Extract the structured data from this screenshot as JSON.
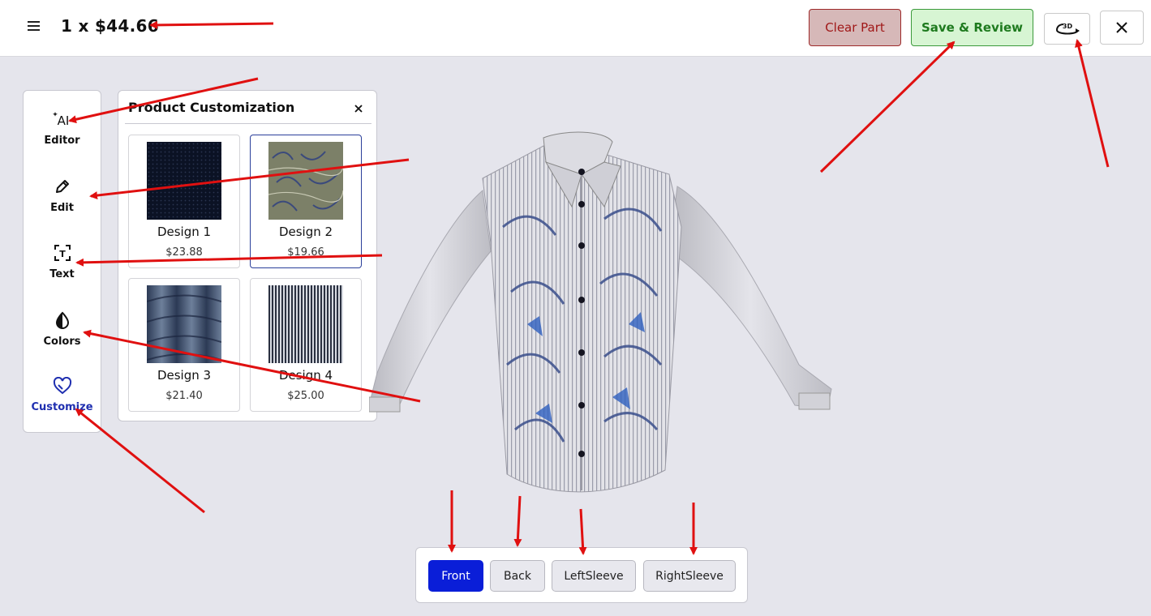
{
  "header": {
    "price_text": "1 x $44.66",
    "clear_label": "Clear Part",
    "save_label": "Save & Review",
    "three_d_label": "3D"
  },
  "toolbar": {
    "items": [
      {
        "label": "Editor",
        "icon": "ai-sparkle-icon",
        "glyph": "AI"
      },
      {
        "label": "Edit",
        "icon": "pencil-icon"
      },
      {
        "label": "Text",
        "icon": "text-frame-icon",
        "glyph": "T"
      },
      {
        "label": "Colors",
        "icon": "half-drop-icon"
      },
      {
        "label": "Customize",
        "icon": "heart-outline-icon"
      }
    ],
    "active": "Customize"
  },
  "panel": {
    "title": "Product Customization",
    "designs": [
      {
        "name": "Design 1",
        "price": "$23.88"
      },
      {
        "name": "Design 2",
        "price": "$19.66"
      },
      {
        "name": "Design 3",
        "price": "$21.40"
      },
      {
        "name": "Design 4",
        "price": "$25.00"
      }
    ],
    "selected": "Design 2"
  },
  "views": {
    "buttons": [
      "Front",
      "Back",
      "LeftSleeve",
      "RightSleeve"
    ],
    "active": "Front"
  },
  "colors": {
    "accent": "#0a1ed8",
    "clear_bg": "#d6b8b8",
    "clear_text": "#a01818",
    "save_bg": "#d7f5d3",
    "save_text": "#1e7a1e",
    "annotation": "#e01010"
  }
}
